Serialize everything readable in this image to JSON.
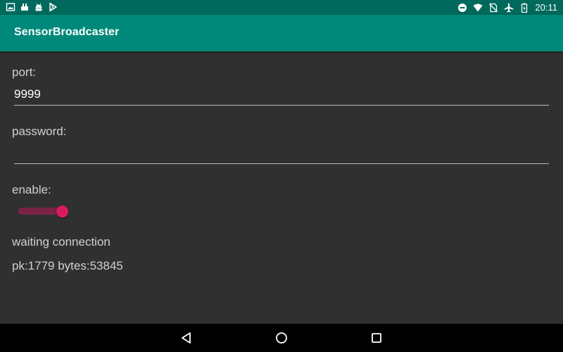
{
  "status_bar": {
    "time": "20:11",
    "left_icons": [
      "image-icon",
      "usb-icon",
      "android-icon",
      "play-store-icon"
    ],
    "right_icons": [
      "do-not-disturb-icon",
      "wifi-icon",
      "no-sim-icon",
      "airplane-icon",
      "battery-charging-icon"
    ]
  },
  "app_bar": {
    "title": "SensorBroadcaster",
    "color": "#00897b"
  },
  "form": {
    "port_label": "port:",
    "port_value": "9999",
    "password_label": "password:",
    "password_value": "",
    "enable_label": "enable:",
    "enable_on": true,
    "switch_color": "#d81b60"
  },
  "status": {
    "connection_text": "waiting connection",
    "stats_text": "pk:1779 bytes:53845"
  },
  "nav_bar": {
    "buttons": [
      "back-icon",
      "home-icon",
      "recents-icon"
    ]
  }
}
